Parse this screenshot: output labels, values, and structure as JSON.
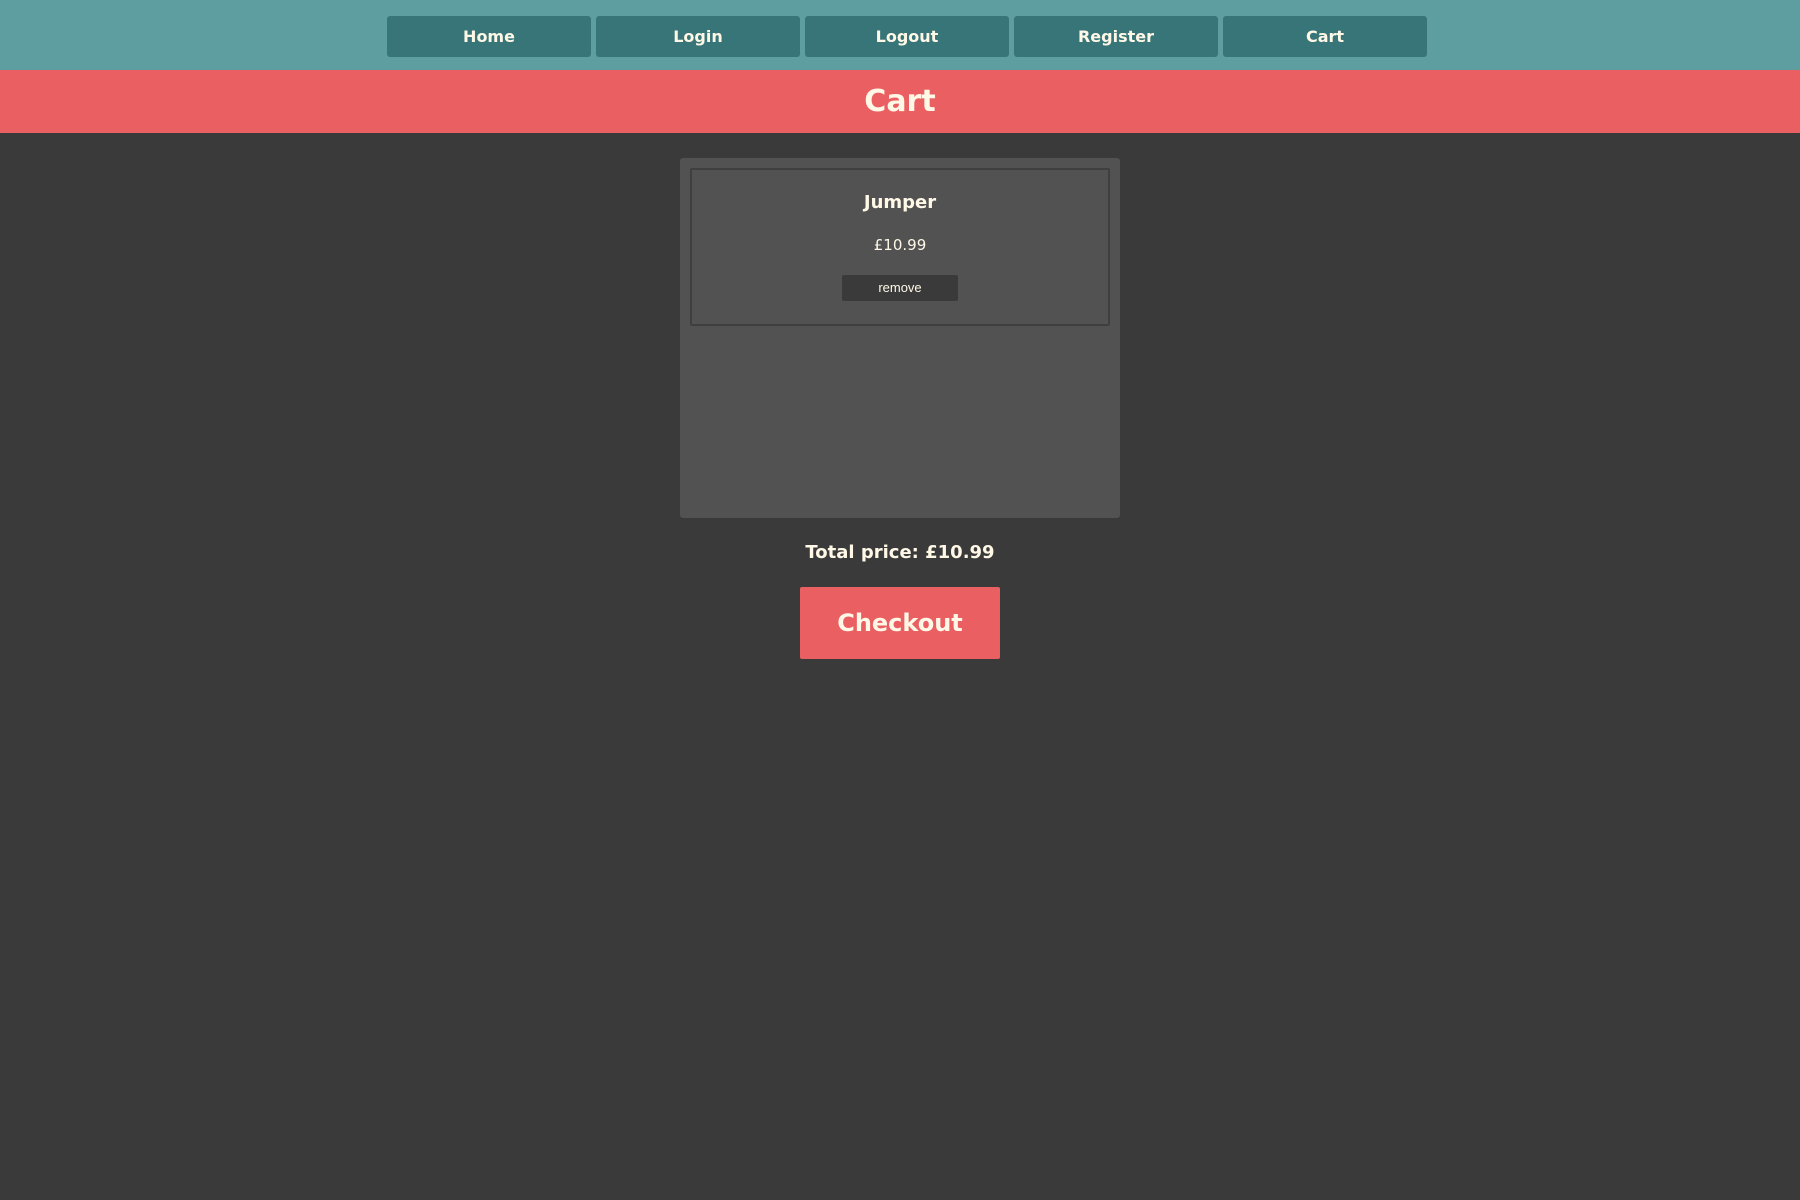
{
  "nav": {
    "items": [
      {
        "label": "Home"
      },
      {
        "label": "Login"
      },
      {
        "label": "Logout"
      },
      {
        "label": "Register"
      },
      {
        "label": "Cart"
      }
    ]
  },
  "page": {
    "title": "Cart"
  },
  "cart": {
    "items": [
      {
        "name": "Jumper",
        "price": "£10.99",
        "remove_label": "remove"
      }
    ],
    "total_label": "Total price: £10.99",
    "checkout_label": "Checkout"
  },
  "colors": {
    "nav_bg": "#5f9ea0",
    "nav_button": "#377578",
    "accent": "#ea5f62",
    "page_bg": "#3a3a3a",
    "panel_bg": "#525252",
    "text": "#fff8e7"
  }
}
